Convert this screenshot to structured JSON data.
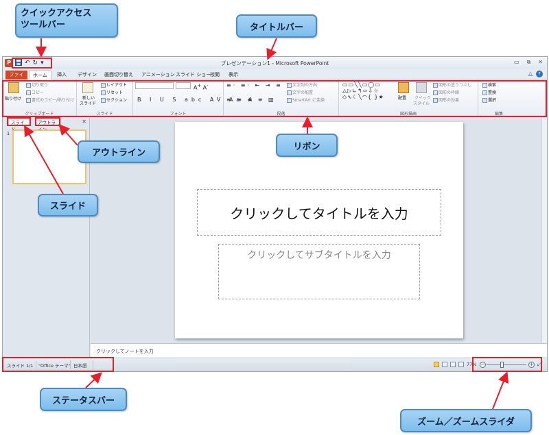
{
  "window": {
    "app_icon": "P",
    "title": "プレゼンテーション1 - Microsoft PowerPoint",
    "qat": {
      "save_icon": "save-icon",
      "undo": "↶",
      "redo": "↻",
      "customize": "▾"
    },
    "controls": {
      "minimize": "▭",
      "restore": "⧉",
      "close": "✕"
    }
  },
  "tabs": {
    "file": "ファイル",
    "home": "ホーム",
    "insert": "挿入",
    "design": "デザイン",
    "transitions": "画面切り替え",
    "animations": "アニメーション",
    "slideshow": "スライド ショー",
    "review": "校閲",
    "view": "表示",
    "collapse": "△",
    "help": "?"
  },
  "ribbon": {
    "clipboard": {
      "label": "クリップボード",
      "paste": "貼り付け",
      "cut": "切り取り",
      "copy": "コピー",
      "format_painter": "書式のコピー/貼り付け"
    },
    "slides": {
      "label": "スライド",
      "new_slide": "新しい",
      "new_slide2": "スライド",
      "layout": "レイアウト",
      "reset": "リセット",
      "section": "セクション"
    },
    "font": {
      "label": "フォント"
    },
    "paragraph": {
      "label": "段落",
      "text_direction": "文字列の方向",
      "align_text": "文字の配置",
      "smartart": "SmartArt に変換"
    },
    "drawing": {
      "label": "図形描画",
      "arrange": "配置",
      "quick_styles": "クイック",
      "quick_styles2": "スタイル",
      "shape_fill": "図形の塗りつぶし",
      "shape_outline": "図形の枠線",
      "shape_effects": "図形の効果"
    },
    "editing": {
      "label": "編集",
      "find": "検索",
      "replace": "置換",
      "select": "選択"
    }
  },
  "left_pane": {
    "tab_slides": "スライド",
    "tab_outline": "アウトライン",
    "close": "✕",
    "thumb_number": "1"
  },
  "slide": {
    "title_placeholder": "クリックしてタイトルを入力",
    "subtitle_placeholder": "クリックしてサブタイトルを入力"
  },
  "notes": {
    "placeholder": "クリックしてノートを入力"
  },
  "statusbar": {
    "slide_count": "スライド 1/1",
    "theme": "\"Office テーマ\"",
    "language": "日本語",
    "zoom": "77%",
    "zoom_out": "−",
    "zoom_in": "+",
    "fit": "⤢"
  },
  "callouts": {
    "qat_line1": "クイックアクセス",
    "qat_line2": "ツールバー",
    "titlebar": "タイトルバー",
    "ribbon": "リボン",
    "outline": "アウトライン",
    "slides": "スライド",
    "statusbar": "ステータスバー",
    "zoom": "ズーム／ズームスライダ"
  },
  "colors": {
    "highlight": "#e81f2a",
    "callout_fill": "#8cc6f0",
    "file_tab": "#d24726"
  }
}
